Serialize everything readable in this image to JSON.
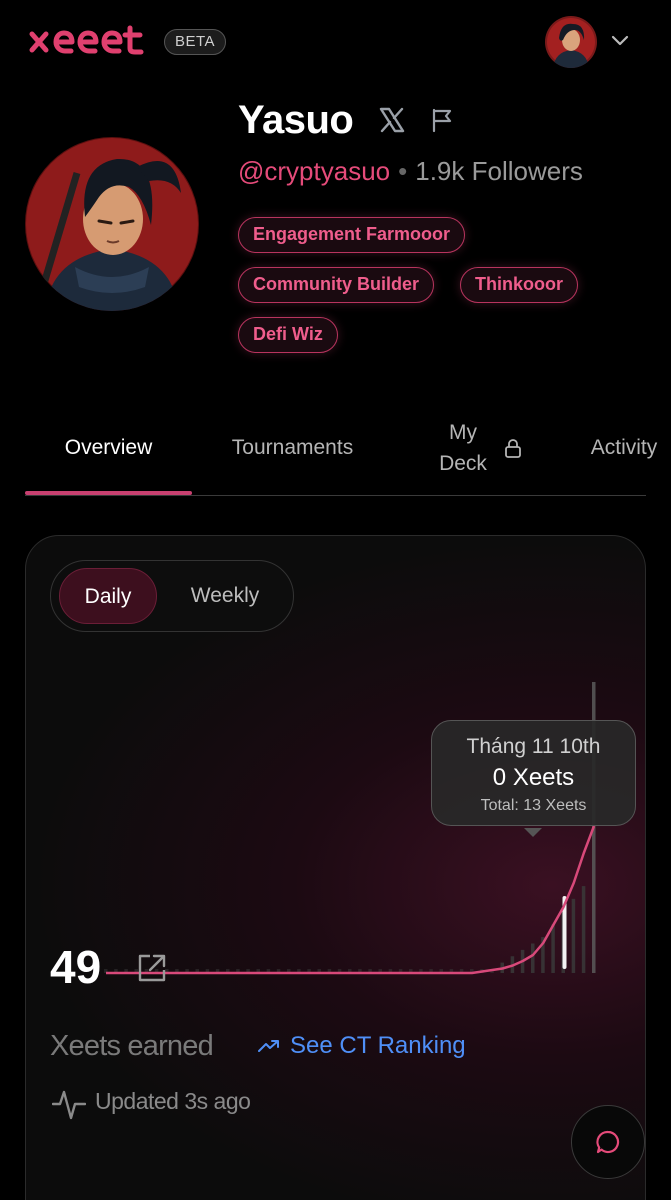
{
  "header": {
    "logo_text": "xeet",
    "beta_label": "BETA",
    "avatar_icon": "user-avatar",
    "menu_icon": "chevron-down-icon"
  },
  "profile": {
    "name": "Yasuo",
    "handle": "@cryptyasuo",
    "separator": "•",
    "followers": "1.9k Followers",
    "badges": [
      "Engagement Farmooor",
      "Community Builder",
      "Thinkooor",
      "Defi Wiz"
    ]
  },
  "tabs": {
    "overview": "Overview",
    "tournaments": "Tournaments",
    "deck_line1": "My",
    "deck_line2": "Deck",
    "activity": "Activity"
  },
  "card": {
    "toggle": {
      "daily": "Daily",
      "weekly": "Weekly",
      "selected": "Daily"
    },
    "tooltip": {
      "date": "Tháng 11 10th",
      "value": "0 Xeets",
      "total": "Total: 13 Xeets"
    },
    "total_xeets": "49",
    "earned_label": "Xeets earned",
    "ranking_link": "See CT Ranking",
    "updated": "Updated 3s ago"
  },
  "chart_data": {
    "type": "area",
    "series": [
      {
        "values": [
          0,
          0,
          0,
          0,
          0,
          0,
          0,
          0,
          0,
          0,
          0,
          0,
          0,
          0,
          0,
          0,
          0,
          0,
          0,
          0,
          0,
          0,
          0,
          0,
          0,
          0,
          0,
          0,
          0,
          0,
          0,
          0,
          0,
          0,
          0,
          0,
          0,
          0.5,
          1,
          1.5,
          2.5,
          4,
          6,
          10,
          16,
          22,
          30,
          40,
          49
        ]
      }
    ],
    "bars": [
      0,
      0,
      0,
      0,
      0,
      0,
      0,
      0,
      0,
      0,
      0,
      0,
      0,
      0,
      0,
      0,
      0,
      0,
      0,
      0,
      0,
      0,
      0,
      0,
      0,
      0,
      0,
      0,
      0,
      0,
      0,
      0,
      0,
      0,
      0,
      0,
      0,
      0,
      0,
      1,
      2,
      3,
      4,
      5,
      7,
      9,
      11,
      13,
      45
    ],
    "grid": false
  },
  "colors": {
    "accent": "#e54b7a",
    "link": "#4f8ff7",
    "background": "#000000"
  },
  "fab_icon": "chat-bubble-icon"
}
